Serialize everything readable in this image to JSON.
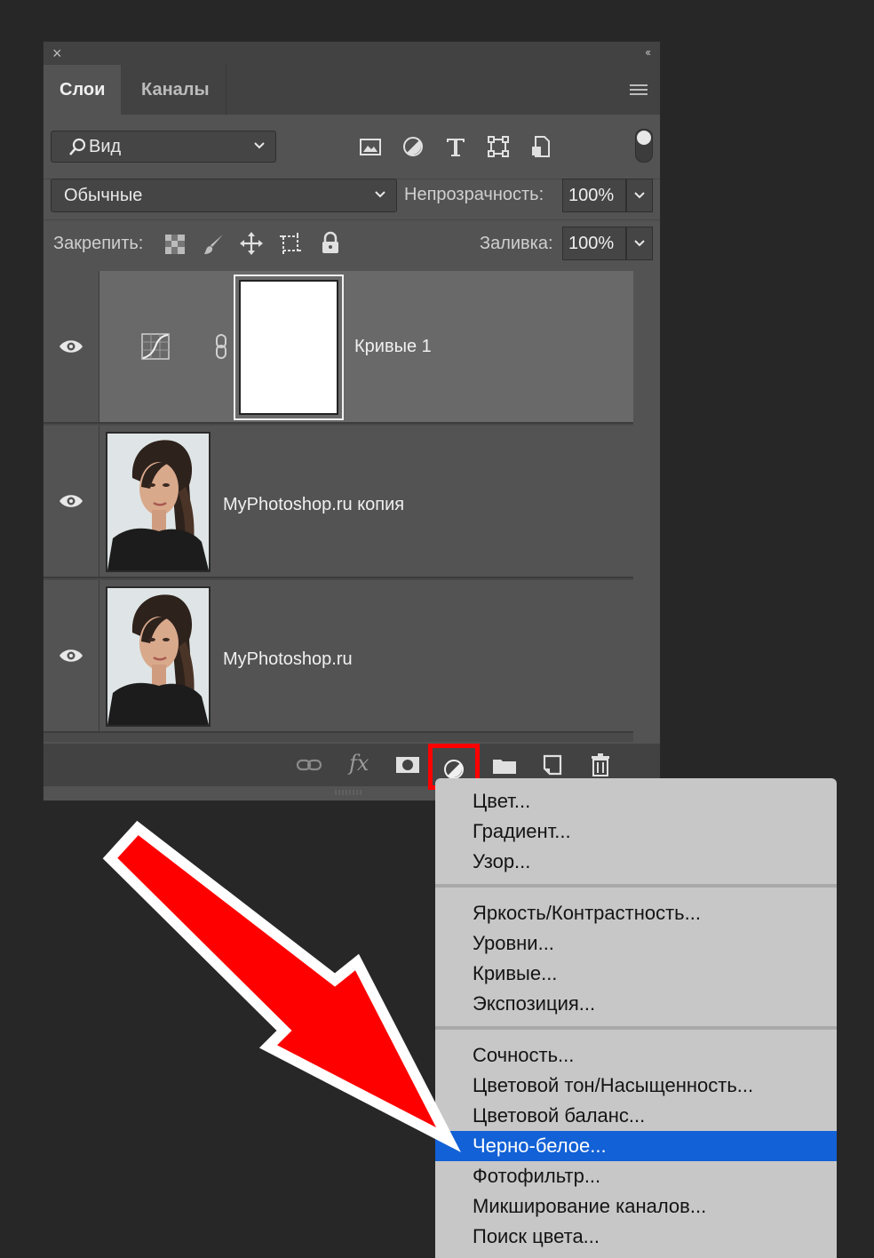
{
  "panel": {
    "close_glyph": "×",
    "collapse_glyph": "‹‹",
    "tabs": [
      {
        "label": "Слои",
        "active": true
      },
      {
        "label": "Каналы",
        "active": false
      }
    ],
    "filter": {
      "search_icon": "search-icon",
      "value": "Вид",
      "filter_icons": [
        "image-filter-icon",
        "adjustment-filter-icon",
        "type-filter-icon",
        "shape-filter-icon",
        "smart-object-filter-icon"
      ]
    },
    "blend": {
      "mode": "Обычные",
      "opacity_label": "Непрозрачность:",
      "opacity_value": "100%"
    },
    "lock": {
      "label": "Закрепить:",
      "fill_label": "Заливка:",
      "fill_value": "100%",
      "icons": [
        "lock-transparent-pixels-icon",
        "lock-image-pixels-icon",
        "lock-position-icon",
        "lock-artboard-icon",
        "lock-all-icon"
      ]
    },
    "layers": [
      {
        "name": "Кривые 1",
        "type": "adjustment",
        "selected": true,
        "visible": true
      },
      {
        "name": "MyPhotoshop.ru копия",
        "type": "image",
        "selected": false,
        "visible": true
      },
      {
        "name": "MyPhotoshop.ru",
        "type": "image",
        "selected": false,
        "visible": true
      }
    ],
    "bottom_icons": [
      "link-layers-icon",
      "fx-icon",
      "layer-mask-icon",
      "adjustment-layer-icon",
      "group-folder-icon",
      "new-layer-icon",
      "trash-icon"
    ],
    "fx_label": "fx"
  },
  "menu": {
    "groups": [
      [
        "Цвет...",
        "Градиент...",
        "Узор..."
      ],
      [
        "Яркость/Контрастность...",
        "Уровни...",
        "Кривые...",
        "Экспозиция..."
      ],
      [
        "Сочность...",
        "Цветовой тон/Насыщенность...",
        "Цветовой баланс...",
        "Черно-белое...",
        "Фотофильтр...",
        "Микширование каналов...",
        "Поиск цвета..."
      ]
    ],
    "highlighted": "Черно-белое..."
  },
  "colors": {
    "accent_highlight": "#1261d6",
    "annotation_red": "#ff0000"
  }
}
